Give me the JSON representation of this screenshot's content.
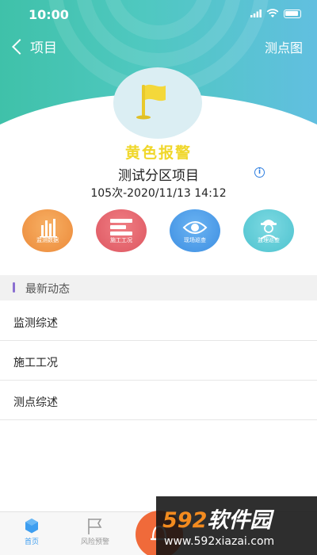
{
  "status_bar": {
    "time": "10:00"
  },
  "nav": {
    "back_label": "项目",
    "right_label": "测点图"
  },
  "alert": {
    "level_label": "黄色报警",
    "project_name": "测试分区项目",
    "record": "105次-2020/11/13 14:12",
    "flag_color": "#f0d72a"
  },
  "actions": [
    {
      "label": "监测数据",
      "icon": "bar-chart-icon"
    },
    {
      "label": "施工工况",
      "icon": "list-icon"
    },
    {
      "label": "现场巡查",
      "icon": "eye-icon"
    },
    {
      "label": "监理巡查",
      "icon": "inspector-icon"
    }
  ],
  "section": {
    "title": "最新动态"
  },
  "list": [
    {
      "label": "监测综述"
    },
    {
      "label": "施工工况"
    },
    {
      "label": "测点综述"
    }
  ],
  "tabbar": {
    "tabs": [
      {
        "label": "首页",
        "icon": "home-cube-icon",
        "active": true
      },
      {
        "label": "风险预警",
        "icon": "flag-icon",
        "active": false
      }
    ]
  },
  "watermark": {
    "logo_prefix": "592",
    "logo_suffix": "软件园",
    "url": "www.592xiazai.com"
  }
}
